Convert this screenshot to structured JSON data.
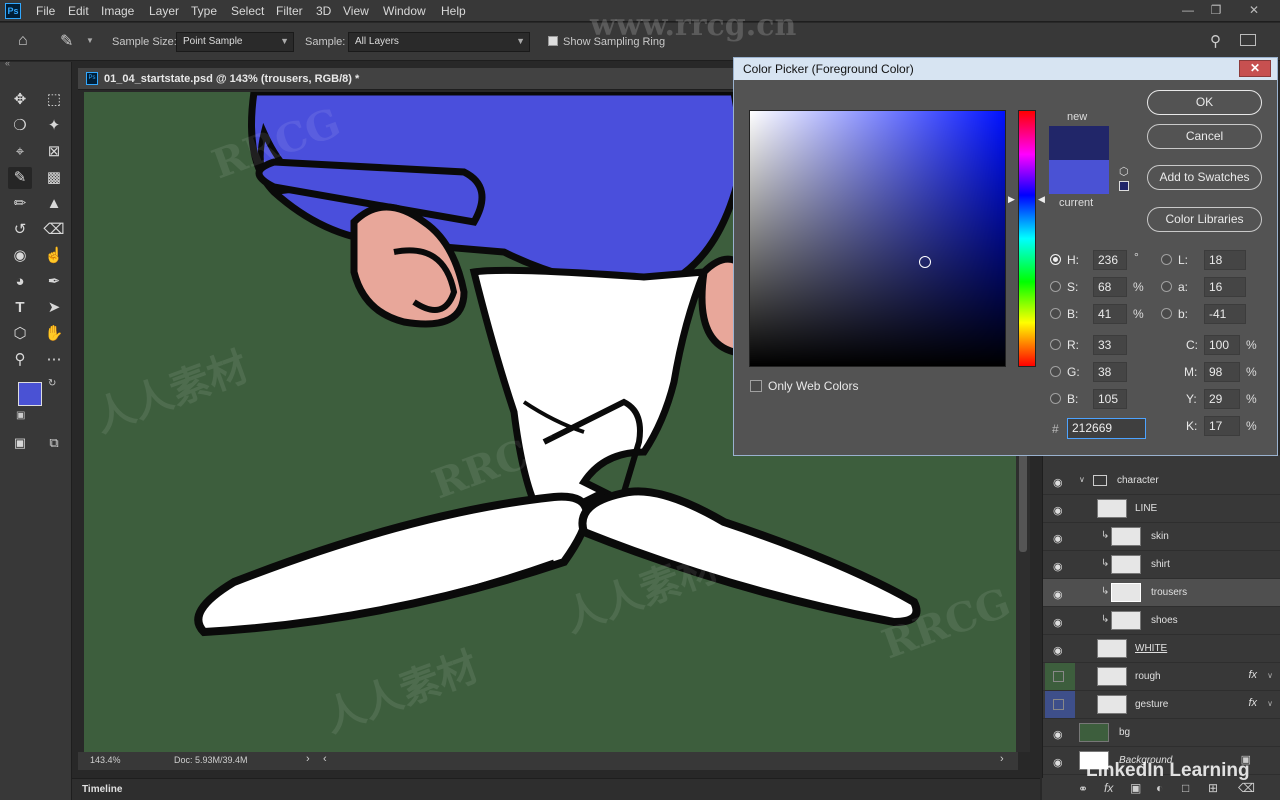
{
  "app": {
    "logo": "Ps"
  },
  "menu": [
    "File",
    "Edit",
    "Image",
    "Layer",
    "Type",
    "Select",
    "Filter",
    "3D",
    "View",
    "Window",
    "Help"
  ],
  "options": {
    "sample_size_label": "Sample Size:",
    "sample_size_value": "Point Sample",
    "sample_label": "Sample:",
    "sample_value": "All Layers",
    "show_ring_label": "Show Sampling Ring",
    "show_ring_checked": true
  },
  "document": {
    "tab_title": "01_04_startstate.psd @ 143% (trousers, RGB/8) *",
    "zoom": "143.4%",
    "doc_info": "Doc: 5.93M/39.4M"
  },
  "colors": {
    "foreground": "#4a52d4",
    "background": "#ffffff",
    "canvas_bg": "#3d5e3d",
    "shirt": "#4a4fdc",
    "skin": "#e8a79a"
  },
  "dialog": {
    "title": "Color Picker (Foreground Color)",
    "close_label": "✕",
    "new_label": "new",
    "current_label": "current",
    "new_color": "#212669",
    "current_color": "#4a52d4",
    "buttons": {
      "ok": "OK",
      "cancel": "Cancel",
      "add_swatches": "Add to Swatches",
      "libraries": "Color Libraries"
    },
    "only_web_label": "Only Web Colors",
    "hsb": {
      "h": "236",
      "s": "68",
      "b": "41",
      "h_unit": "°",
      "s_unit": "%",
      "b_unit": "%"
    },
    "rgb": {
      "r": "33",
      "g": "38",
      "b": "105"
    },
    "lab": {
      "l": "18",
      "a": "16",
      "b": "-41"
    },
    "cmyk": {
      "c": "100",
      "m": "98",
      "y": "29",
      "k": "17"
    },
    "hex": "212669",
    "labels": {
      "h": "H:",
      "s": "S:",
      "b": "B:",
      "r": "R:",
      "g": "G:",
      "bb": "B:",
      "l": "L:",
      "a": "a:",
      "lb": "b:",
      "c": "C:",
      "m": "M:",
      "y": "Y:",
      "k": "K:",
      "hash": "#"
    },
    "pct": "%"
  },
  "layers": [
    {
      "name": "character",
      "type": "group"
    },
    {
      "name": "LINE",
      "type": "layer"
    },
    {
      "name": "skin",
      "type": "clipped"
    },
    {
      "name": "shirt",
      "type": "clipped"
    },
    {
      "name": "trousers",
      "type": "clipped",
      "selected": true
    },
    {
      "name": "shoes",
      "type": "clipped"
    },
    {
      "name": "WHITE",
      "type": "layer"
    },
    {
      "name": "rough",
      "type": "layer",
      "fx": "fx"
    },
    {
      "name": "gesture",
      "type": "layer",
      "fx": "fx"
    },
    {
      "name": "bg",
      "type": "layer"
    },
    {
      "name": "Background",
      "type": "locked"
    }
  ],
  "timeline_label": "Timeline",
  "watermarks": [
    "www.rrcg.cn",
    "RRCG",
    "人人素材",
    "LinkedIn Learning"
  ]
}
